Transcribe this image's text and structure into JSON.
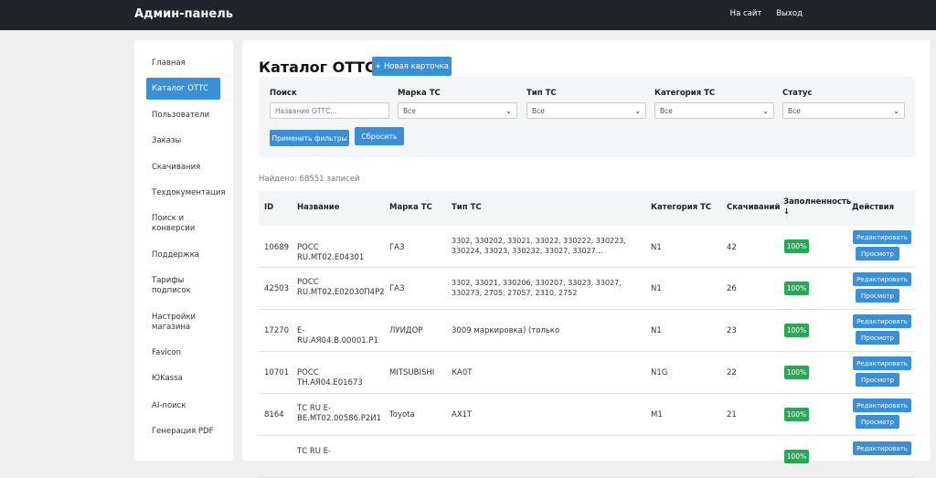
{
  "header": {
    "brand": "Админ-панель",
    "nav": [
      "На сайт",
      "Выход"
    ]
  },
  "sidebar": {
    "items": [
      {
        "label": "Главная",
        "active": false
      },
      {
        "label": "Каталог ОТТС",
        "active": true
      },
      {
        "label": "Пользователи",
        "active": false
      },
      {
        "label": "Заказы",
        "active": false
      },
      {
        "label": "Скачивания",
        "active": false
      },
      {
        "label": "Техдокументация",
        "active": false
      },
      {
        "label": "Поиск и конверсии",
        "active": false
      },
      {
        "label": "Поддержка",
        "active": false
      },
      {
        "label": "Тарифы подписок",
        "active": false
      },
      {
        "label": "Настройки магазина",
        "active": false
      },
      {
        "label": "Favicon",
        "active": false
      },
      {
        "label": "ЮKassa",
        "active": false
      },
      {
        "label": "AI-поиск",
        "active": false
      },
      {
        "label": "Генерация PDF",
        "active": false
      }
    ]
  },
  "main": {
    "title": "Каталог ОТТС",
    "new_card_label": "+ Новая карточка",
    "filters": {
      "search_label": "Поиск",
      "search_placeholder": "Название ОТТС...",
      "brand_label": "Марка ТС",
      "brand_value": "Все",
      "type_label": "Тип ТС",
      "type_value": "Все",
      "category_label": "Категория ТС",
      "category_value": "Все",
      "status_label": "Статус",
      "status_value": "Все",
      "apply_label": "Применить фильтры",
      "reset_label": "Сбросить"
    },
    "found_text": "Найдено: 68551 записей",
    "table": {
      "columns": [
        "ID",
        "Название",
        "Марка ТС",
        "Тип ТС",
        "Категория ТС",
        "Скачиваний",
        "Заполненность ↓",
        "Действия"
      ],
      "edit_label": "Редактировать",
      "view_label": "Просмотр",
      "rows": [
        {
          "id": "10689",
          "name": "РОСС RU.МТ02.Е04301",
          "brand": "ГАЗ",
          "type": "3302, 330202, 33021, 33022, 330222, 330223, 330224, 33023, 330232, 33027, 33027...",
          "category": "N1",
          "downloads": "42",
          "fill": "100%"
        },
        {
          "id": "42503",
          "name": "РОСС RU.МТ02.Е02030П4Р2",
          "brand": "ГАЗ",
          "type": "3302, 33021, 330206, 330207, 33023, 33027, 330273, 2705, 27057, 2310, 2752",
          "category": "N1",
          "downloads": "26",
          "fill": "100%"
        },
        {
          "id": "17270",
          "name": "E-RU.АЯ04.В.00001.Р1",
          "brand": "ЛУИДОР",
          "type": "3009 маркировка) (только",
          "category": "N1",
          "downloads": "23",
          "fill": "100%"
        },
        {
          "id": "10701",
          "name": "РОСС TH.АЯ04.Е01673",
          "brand": "MITSUBISHI",
          "type": "КА0Т",
          "category": "N1G",
          "downloads": "22",
          "fill": "100%"
        },
        {
          "id": "8164",
          "name": "ТС RU E-BE.МТ02.00586.Р2И1",
          "brand": "Toyota",
          "type": "AX1T",
          "category": "M1",
          "downloads": "21",
          "fill": "100%"
        },
        {
          "id": "",
          "name": "ТС RU E-",
          "brand": "",
          "type": "",
          "category": "",
          "downloads": "",
          "fill": "100%"
        }
      ]
    }
  },
  "colors": {
    "accent": "#3b8fd6",
    "success": "#2fa35a",
    "topbar": "#212529"
  }
}
